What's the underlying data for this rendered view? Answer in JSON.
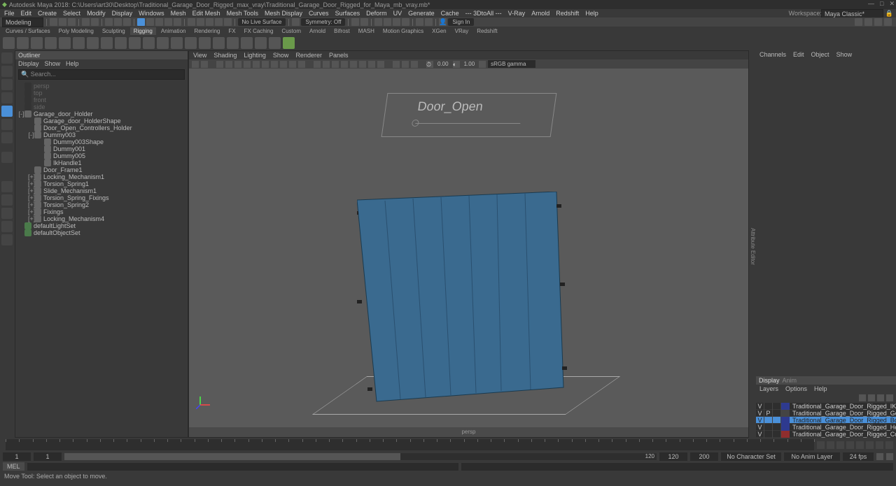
{
  "title": "Autodesk Maya 2018: C:\\Users\\art30\\Desktop\\Traditional_Garage_Door_Rigged_max_vray\\Traditional_Garage_Door_Rigged_for_Maya_mb_vray.mb*",
  "workspace_label": "Workspace:",
  "workspace_value": "Maya Classic*",
  "menu": [
    "File",
    "Edit",
    "Create",
    "Select",
    "Modify",
    "Display",
    "Windows",
    "Mesh",
    "Edit Mesh",
    "Mesh Tools",
    "Mesh Display",
    "Curves",
    "Surfaces",
    "Deform",
    "UV",
    "Generate",
    "Cache",
    "--- 3DtoAll ---",
    "V-Ray",
    "Arnold",
    "Redshift",
    "Help"
  ],
  "mode": "Modeling",
  "live": "No Live Surface",
  "sym": "Symmetry: Off",
  "signin": "Sign In",
  "shelf_tabs": [
    "Curves / Surfaces",
    "Poly Modeling",
    "Sculpting",
    "Rigging",
    "Animation",
    "Rendering",
    "FX",
    "FX Caching",
    "Custom",
    "Arnold",
    "Bifrost",
    "MASH",
    "Motion Graphics",
    "XGen",
    "VRay",
    "Redshift"
  ],
  "shelf_active": "Rigging",
  "outliner": {
    "title": "Outliner",
    "menu": [
      "Display",
      "Show",
      "Help"
    ],
    "search": "Search...",
    "items": [
      {
        "d": 0,
        "t": "persp",
        "dim": true,
        "cam": true
      },
      {
        "d": 0,
        "t": "top",
        "dim": true,
        "cam": true
      },
      {
        "d": 0,
        "t": "front",
        "dim": true,
        "cam": true
      },
      {
        "d": 0,
        "t": "side",
        "dim": true,
        "cam": true
      },
      {
        "d": 0,
        "t": "Garage_door_Holder",
        "ex": "-"
      },
      {
        "d": 1,
        "t": "Garage_door_HolderShape"
      },
      {
        "d": 1,
        "t": "Door_Open_Controllers_Holder"
      },
      {
        "d": 1,
        "t": "Dummy003",
        "ex": "-"
      },
      {
        "d": 2,
        "t": "Dummy003Shape"
      },
      {
        "d": 2,
        "t": "Dummy001"
      },
      {
        "d": 2,
        "t": "Dummy005"
      },
      {
        "d": 2,
        "t": "IkHandle1"
      },
      {
        "d": 1,
        "t": "Door_Frame1"
      },
      {
        "d": 1,
        "t": "Locking_Mechanism1",
        "ex": "+"
      },
      {
        "d": 1,
        "t": "Torsion_Spring1",
        "ex": "+"
      },
      {
        "d": 1,
        "t": "Slide_Mechanism1",
        "ex": "+"
      },
      {
        "d": 1,
        "t": "Torsion_Spring_Fixings",
        "ex": "+"
      },
      {
        "d": 1,
        "t": "Torsion_Spring2",
        "ex": "+"
      },
      {
        "d": 1,
        "t": "Fixings",
        "ex": "+"
      },
      {
        "d": 1,
        "t": "Locking_Mechanism4",
        "ex": "+"
      },
      {
        "d": 0,
        "t": "defaultLightSet",
        "set": true
      },
      {
        "d": 0,
        "t": "defaultObjectSet",
        "set": true
      }
    ]
  },
  "vp": {
    "menu": [
      "View",
      "Shading",
      "Lighting",
      "Show",
      "Renderer",
      "Panels"
    ],
    "time": "0.00",
    "field": "1.00",
    "gamma": "sRGB gamma",
    "overlay": "Door_Open",
    "foot": "persp"
  },
  "channels_menu": [
    "Channels",
    "Edit",
    "Object",
    "Show"
  ],
  "layers": {
    "tabs": [
      "Display",
      "Anim"
    ],
    "menu": [
      "Layers",
      "Options",
      "Help"
    ],
    "rows": [
      {
        "v": "V",
        "p": "",
        "c": "#2e3a8f",
        "n": "Traditional_Garage_Door_Rigged_IK_Chain"
      },
      {
        "v": "V",
        "p": "P",
        "c": "#444",
        "n": "Traditional_Garage_Door_Rigged_Geometry"
      },
      {
        "v": "V",
        "p": "",
        "c": "#2e3a8f",
        "n": "Traditional_Garage_Door_Rigged_Bones",
        "sel": true
      },
      {
        "v": "V",
        "p": "",
        "c": "#2e3a8f",
        "n": "Traditional_Garage_Door_Rigged_Helpers"
      },
      {
        "v": "V",
        "p": "",
        "c": "#8f2e2e",
        "n": "Traditional_Garage_Door_Rigged_Controllers"
      }
    ]
  },
  "time": {
    "start": "1",
    "rstart": "1",
    "cur": "120",
    "rend": "120",
    "end": "200",
    "charset": "No Character Set",
    "animlayer": "No Anim Layer",
    "fps": "24 fps"
  },
  "cmd": "MEL",
  "status": "Move Tool: Select an object to move."
}
